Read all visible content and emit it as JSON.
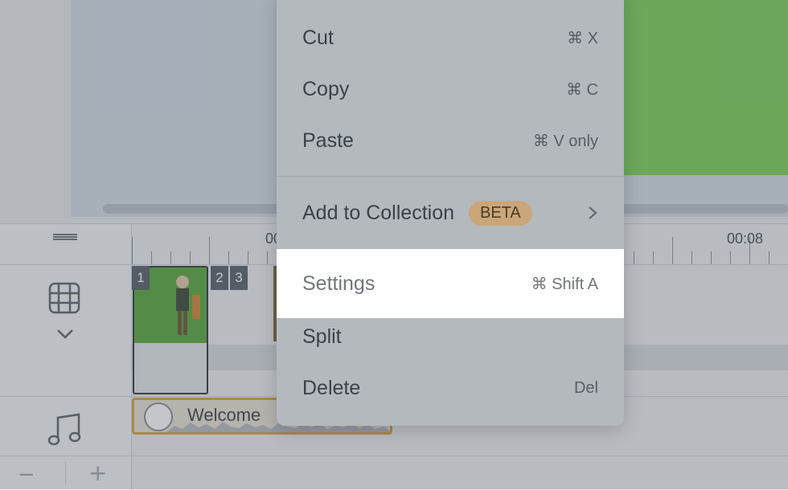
{
  "menu": {
    "items": [
      {
        "label": "Cut",
        "shortcut": "⌘ X"
      },
      {
        "label": "Copy",
        "shortcut": "⌘ C"
      },
      {
        "label": "Paste",
        "shortcut": "⌘ V only"
      },
      {
        "label": "Add to Collection",
        "badge": "BETA",
        "icon": "chevron-right-icon"
      },
      {
        "label": "Settings",
        "shortcut": "⌘ Shift A",
        "highlighted": true
      },
      {
        "label": "Split",
        "shortcut": ""
      },
      {
        "label": "Delete",
        "shortcut": "Del"
      }
    ]
  },
  "timeline": {
    "ruler_labels": [
      "00",
      "00:08"
    ],
    "scene_badges": [
      "1",
      "2",
      "3"
    ],
    "audio_clip_title": "Welcome",
    "zoom_out_label": "−",
    "zoom_in_label": "+"
  },
  "icons": {
    "drag_handle": "drag-handle-icon",
    "video_track": "film-grid-icon",
    "expand": "chevron-down-icon",
    "audio_track": "music-note-icon"
  },
  "colors": {
    "accent_green": "#7fd15c",
    "audio_clip_border": "#d9a441",
    "beta_badge": "#c9a77a",
    "highlight": "#ffffff"
  }
}
